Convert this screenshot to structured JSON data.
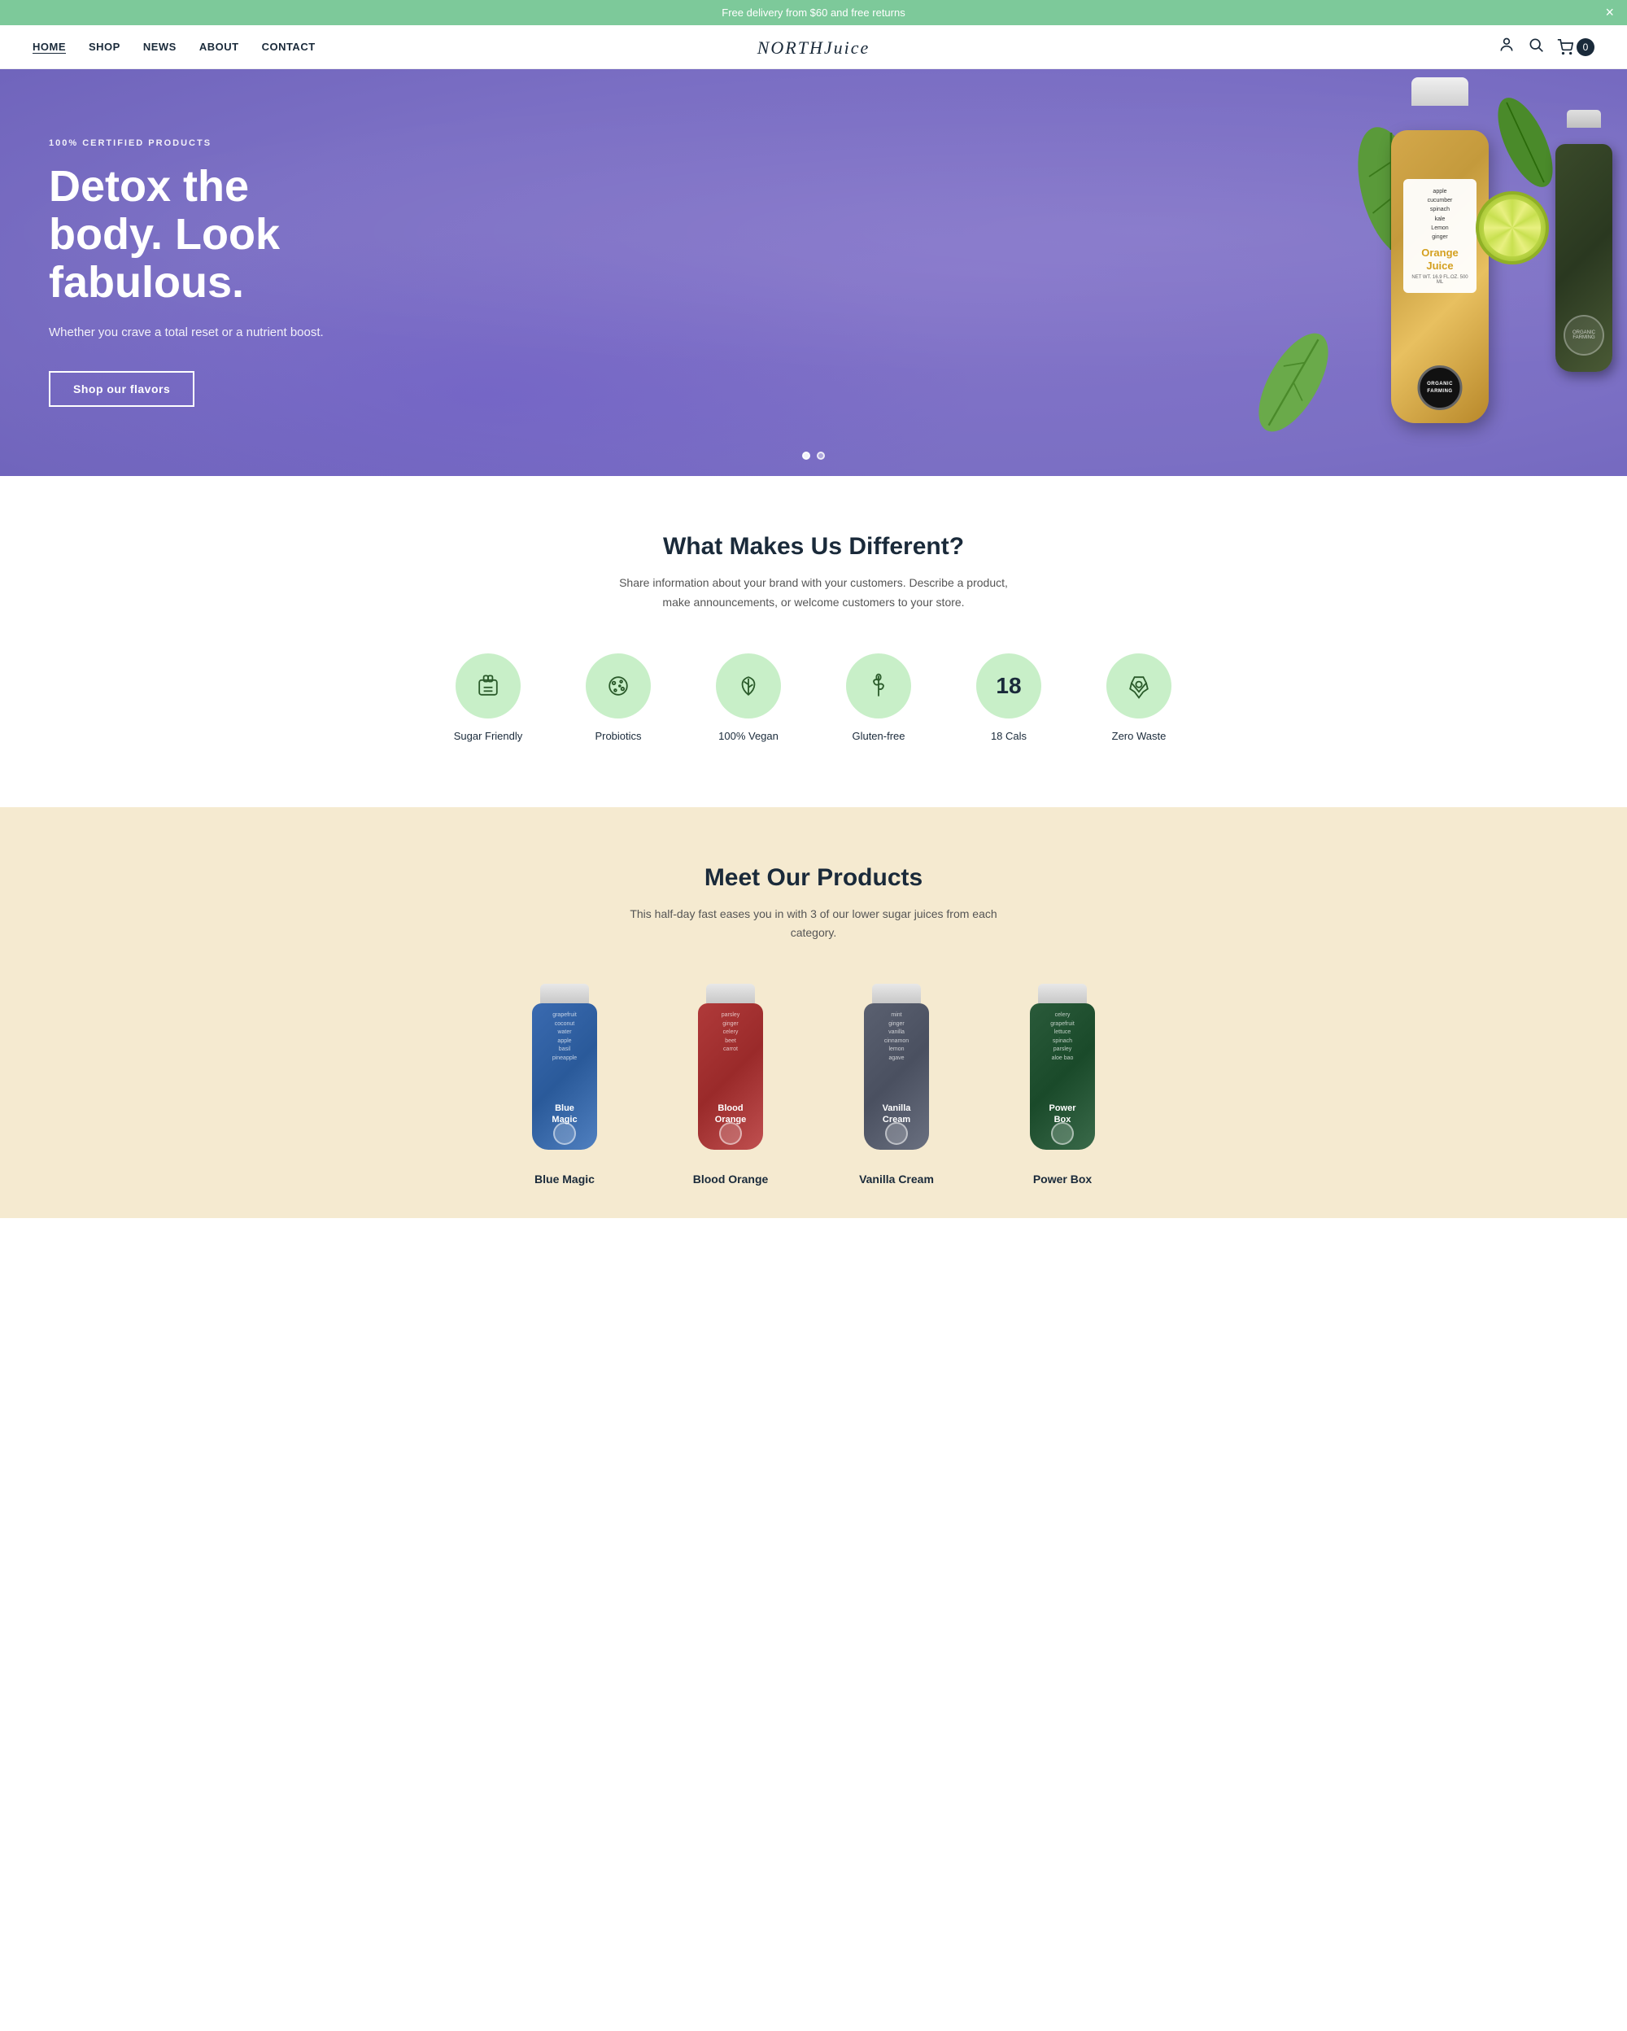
{
  "announcement": {
    "text": "Free delivery from $60 and free returns",
    "close_label": "×"
  },
  "nav": {
    "items": [
      {
        "label": "HOME",
        "active": true
      },
      {
        "label": "SHOP",
        "active": false
      },
      {
        "label": "NEWS",
        "active": false
      },
      {
        "label": "ABOUT",
        "active": false
      },
      {
        "label": "CONTACT",
        "active": false
      }
    ],
    "logo_text": "NORTH",
    "logo_italic": "Juice",
    "cart_count": "0"
  },
  "hero": {
    "badge": "100% CERTIFIED PRODUCTS",
    "title": "Detox the body. Look fabulous.",
    "subtitle": "Whether you crave a total reset or a nutrient boost.",
    "cta_label": "Shop our flavors",
    "bottle_label_ingredients": "apple\ncucumber\nspinach\nkale\nLemon\nginger",
    "bottle_label_name": "Orange\nJuice",
    "organic_text": "ORGANIC\nFARMING",
    "dots": [
      true,
      false
    ]
  },
  "features": {
    "title": "What Makes Us Different?",
    "subtitle": "Share information about your brand with your customers. Describe a product, make announcements, or welcome customers to your store.",
    "items": [
      {
        "icon": "🧃",
        "label": "Sugar Friendly"
      },
      {
        "icon": "🌿",
        "label": "Probiotics"
      },
      {
        "icon": "🍃",
        "label": "100% Vegan"
      },
      {
        "icon": "🌾",
        "label": "Gluten-free"
      },
      {
        "number": "18",
        "label": "18 Cals"
      },
      {
        "icon": "♻",
        "label": "Zero Waste"
      }
    ]
  },
  "products": {
    "title": "Meet Our Products",
    "subtitle": "This half-day fast eases you in with 3 of our lower sugar juices from each category.",
    "items": [
      {
        "name": "Blue Magic",
        "color_class": "blue-bottle"
      },
      {
        "name": "Blood Orange",
        "color_class": "red-bottle"
      },
      {
        "name": "Vanilla Cream",
        "color_class": "gray-bottle"
      },
      {
        "name": "Power Box",
        "color_class": "green-bottle"
      }
    ]
  }
}
